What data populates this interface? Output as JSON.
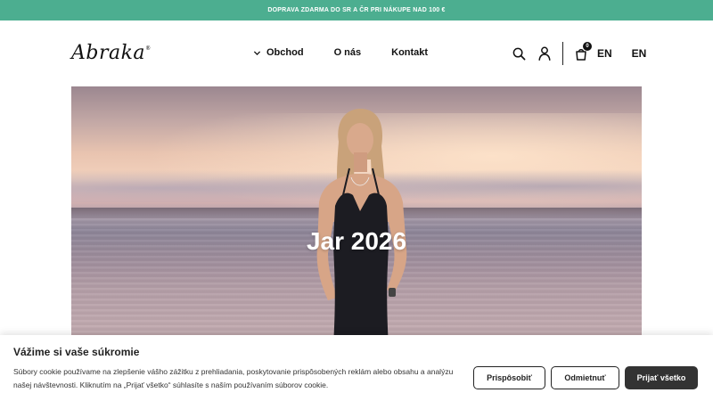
{
  "promo": {
    "text": "DOPRAVA ZDARMA DO SR A ČR PRI NÁKUPE NAD 100 €"
  },
  "header": {
    "logo": "Abraka",
    "logo_mark": "®",
    "nav": {
      "shop": "Obchod",
      "about": "O nás",
      "contact": "Kontakt"
    },
    "cart_count": "0",
    "lang_primary": "EN",
    "lang_secondary": "EN",
    "icons": [
      "search-icon",
      "account-icon",
      "cart-icon",
      "chevron-down-icon"
    ]
  },
  "hero": {
    "title": "Jar 2026"
  },
  "cookie": {
    "title": "Vážime si vaše súkromie",
    "text": "Súbory cookie používame na zlepšenie vášho zážitku z prehliadania, poskytovanie prispôsobených reklám alebo obsahu a analýzu našej návštevnosti. Kliknutím na „Prijať všetko“ súhlasíte s naším používaním súborov cookie.",
    "customize_label": "Prispôsobiť",
    "reject_label": "Odmietnuť",
    "accept_label": "Prijať všetko"
  },
  "colors": {
    "promo_bg": "#4cae90",
    "accept_bg": "#333333",
    "text": "#111111"
  }
}
